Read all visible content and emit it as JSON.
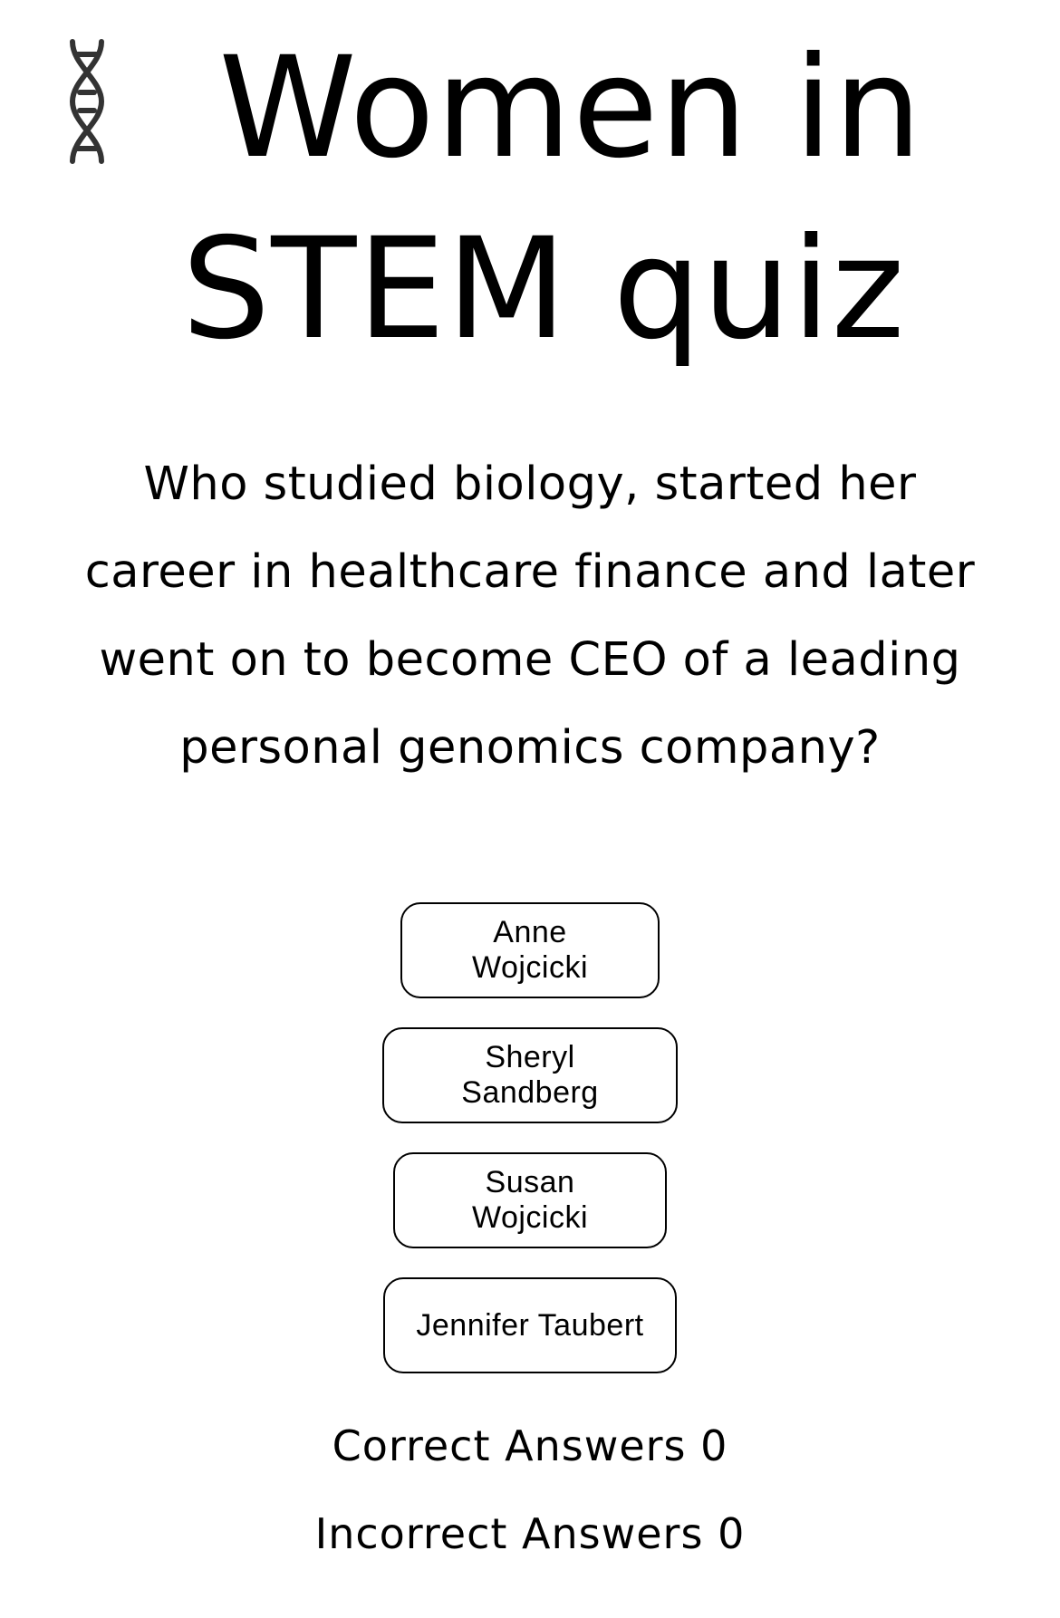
{
  "header": {
    "icon": "dna-icon",
    "title": "Women in STEM quiz"
  },
  "question": {
    "text": "Who studied biology, started her career in healthcare finance and later went on to become CEO of a leading personal genomics company?"
  },
  "answers": [
    {
      "label": "Anne Wojcicki"
    },
    {
      "label": "Sheryl Sandberg"
    },
    {
      "label": "Susan Wojcicki"
    },
    {
      "label": "Jennifer Taubert"
    }
  ],
  "scores": {
    "correct_label": "Correct Answers",
    "correct_count": "0",
    "incorrect_label": "Incorrect Answers",
    "incorrect_count": "0"
  },
  "colors": {
    "background": "#ffffff",
    "text": "#000000",
    "icon": "#333333",
    "button_border": "#000000"
  }
}
